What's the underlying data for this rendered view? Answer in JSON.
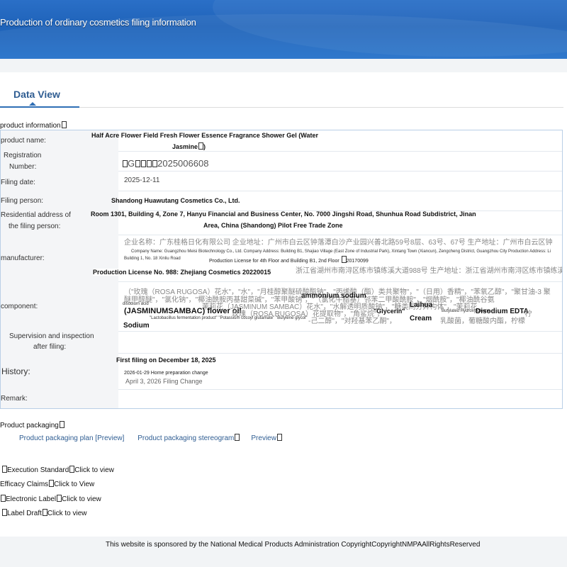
{
  "header": {
    "title": "Production of ordinary cosmetics filing information"
  },
  "tab": {
    "label": "Data View"
  },
  "product_info": {
    "section_title": "product information",
    "product_name_label": "product name:",
    "product_name_line1": "Half Acre Flower Field Fresh Flower Essence Fragrance Shower Gel (Water",
    "product_name_line2": "Jasmine",
    "registration_label_1": "Registration",
    "registration_label_2": "Number:",
    "registration_number": "2025006608",
    "filing_date_label": "Filing date:",
    "filing_date": "2025-12-11",
    "filing_person_label": "Filing person:",
    "filing_person": "Shandong Huawutang Cosmetics Co., Ltd.",
    "address_label_1": "Residential address of",
    "address_label_2": "the filing person:",
    "address_line1": "Room 1301, Building 4, Zone 7, Hanyu Financial and Business Center, No. 7000 Jingshi Road, Shunhua Road Subdistrict, Jinan",
    "address_line2": "Area, China (Shandong) Pilot Free Trade Zone",
    "manufacturer_label": "manufacturer:",
    "manufacturer_cn": "企业名称：广东桂格日化有限公司 企业地址：广州市白云区钟落潭白沙产业园兴善北路59号8层、63号、67号 生产地址：广州市白云区钟",
    "manufacturer_en": "Company Name: Guangzhou Meisi Biotechnology Co., Ltd. Company Address: Building B1, Shajiao Village (East Zone of Industrial Park), Xintang Town (Xiancun), Zengcheng District, Guangzhou City Production Address: Li",
    "manufacturer_en2": "Building 1, No. 18 Xinliu Road",
    "manufacturer_en3": "Production License for 4th Floor and Building B1, 2nd Floor",
    "manufacturer_en3_num": "20170099",
    "manufacturer_cn2": "浙江省湖州市南浔区练市镇练溪大道988号 生产地址：浙江省湖州市南浔区练市镇练溪大道",
    "manufacturer_license": "Production License No. 988: Zhejiang Cosmetics 20220015",
    "component_label": "component:",
    "component_cn1": "（\"玫瑰（ROSA RUGOSA）花水\"，\"水\"，\"月桂醇聚醚硫酸酯钠\"，\"丙烯酸（酯）类共聚物\"，\"（日用）香精\"，\"苯氧乙醇\"，\"聚甘油-3 聚",
    "component_cn2": "醚甲醇醚\"，\"氯化钠\"，\"椰油酰胺丙基甜菜碱\"，\"苯甲酸钠\"，\"（氯化牛脂基）邻苯二甲酸酰胺\"，\"烟酰胺\"，\"椰油酰谷氨",
    "component_small1": "disodium acid",
    "component_ammonium": "ammonium sodium",
    "component_cn3": "茉莉花（JASMINUM SAMBAC）花水\"，\"水解透明质酸钠\"，\"糖类同分异构体\"，\"茉莉花",
    "component_laihua": "Laihua",
    "component_en_flower": "(JASMINUMSAMBAC) flower oil",
    "component_cn4": "玫瑰（ROSA RUGOSA）花提取物\"，\"角鲨烷\"，",
    "component_glycerin": "\"Glycerin\"",
    "component_butylated": "Butylated Hydroxytoluene",
    "component_edta": "Disodium EDTA",
    "component_cn5": "\"柠",
    "component_small2": "\"Lactobacillus fermentation product\" \"Potassium cocoyl glutamate\" \"Butylene glycol\"",
    "component_cn6": "-己二醇\"，\"对羟基苯乙酮\"，",
    "component_cream": "Cream",
    "component_cn7": "乳酸菌，葡糖酸内酯，柠檬",
    "component_sodium": "Sodium",
    "supervision_label_1": "Supervision and inspection",
    "supervision_label_2": "after filing:",
    "history_label": "History:",
    "history_1": "First filing on December 18, 2025",
    "history_2": "2026-01-29 Home preparation change",
    "history_3": "April 3, 2026 Filing Change",
    "remark_label": "Remark:"
  },
  "packaging": {
    "section_title": "Product packaging",
    "plan_link": "Product packaging plan [Preview]",
    "stereogram_link": "Product packaging stereogram",
    "stereogram_preview": "Preview"
  },
  "links": {
    "execution_standard": "Execution Standard",
    "efficacy_claims": "Efficacy Claims",
    "electronic_label": "Electronic Label",
    "label_draft": "Label Draft",
    "click_to_view": "Click to view",
    "click_to_view_cap": "Click to View"
  },
  "footer": {
    "text": "This website is sponsored by the National Medical Products Administration CopyrightCopyrightNMPAAllRightsReserved"
  }
}
